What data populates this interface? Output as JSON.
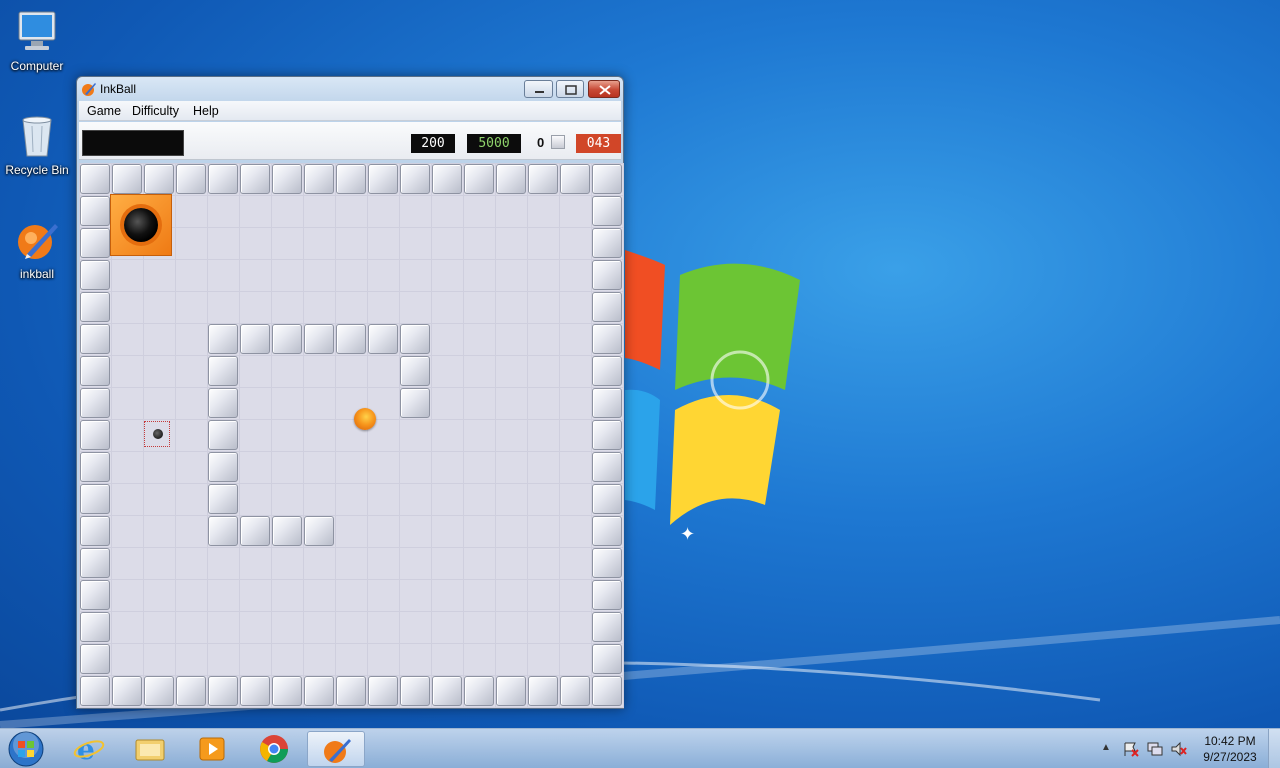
{
  "desktop": {
    "icons": [
      {
        "label": "Computer"
      },
      {
        "label": "Recycle Bin"
      },
      {
        "label": "inkball"
      }
    ]
  },
  "window": {
    "title": "InkBall",
    "menu": [
      "Game",
      "Difficulty",
      "Help"
    ],
    "hud": {
      "score": "200",
      "target": "5000",
      "balls_count": "0",
      "timer": "043"
    }
  },
  "colors": {
    "goal_orange": "#f08a1c",
    "timer_red": "#d14628",
    "target_green": "#8fd36b"
  },
  "taskbar": {
    "apps": [
      "internet-explorer-icon",
      "file-explorer-icon",
      "media-player-icon",
      "chrome-icon",
      "inkball-icon"
    ],
    "active_app": "InkBall",
    "clock_time": "10:42 PM",
    "clock_date": "9/27/2023"
  }
}
